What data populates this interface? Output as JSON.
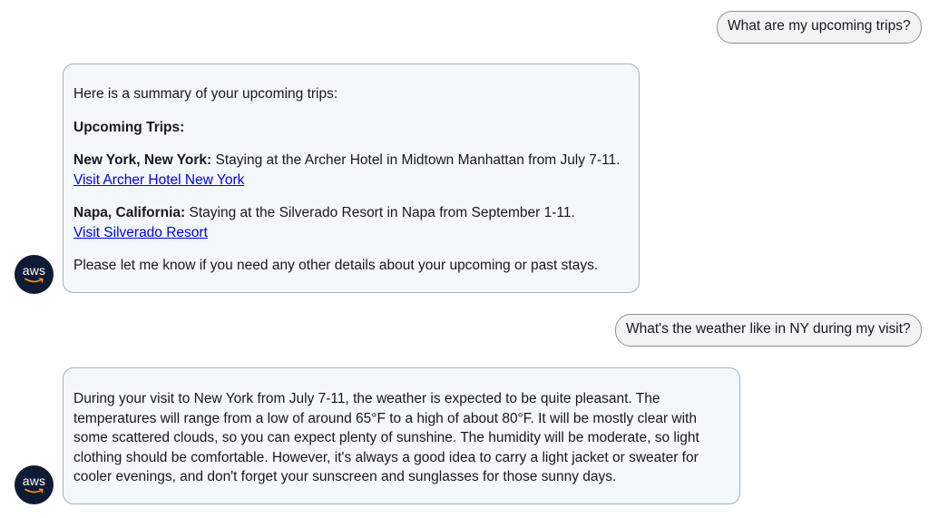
{
  "conversation": {
    "user_msg_1": "What are my upcoming trips?",
    "bot_msg_1": {
      "intro": "Here is a summary of your upcoming trips:",
      "heading": "Upcoming Trips:",
      "trips": [
        {
          "place": "New York, New York:",
          "details": "Staying at the Archer Hotel in Midtown Manhattan from July 7-11.",
          "link": "Visit Archer Hotel New York"
        },
        {
          "place": "Napa, California:",
          "details": "Staying at the Silverado Resort in Napa from September 1-11.",
          "link": "Visit Silverado Resort"
        }
      ],
      "closing": "Please let me know if you need any other details about your upcoming or past stays."
    },
    "user_msg_2": "What's the weather like in NY during my visit?",
    "bot_msg_2": {
      "lines": [
        "During your visit to New York from July 7-11, the weather is expected to be quite pleasant. The",
        "temperatures will range from a low of around 65°F to a high of about 80°F. It will be mostly clear with",
        "some scattered clouds, so you can expect plenty of sunshine. The humidity will be moderate, so light",
        "clothing should be comfortable. However, it's always a good idea to carry a light jacket or sweater for",
        "cooler evenings, and don't forget your sunscreen and sunglasses for those sunny days."
      ]
    },
    "avatar_label": "aws",
    "avatar_icon": "aws-smile-icon",
    "colors": {
      "avatar_bg": "#0f1b35",
      "bot_bubble_bg": "#f3f8fc",
      "user_bubble_bg": "#f2f3f3",
      "link": "#0000ee",
      "aws_orange": "#ff9900"
    }
  }
}
